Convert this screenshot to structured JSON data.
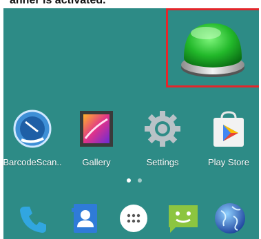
{
  "caption": "anner is activated.",
  "apps": [
    {
      "label": "BarcodeScan..",
      "icon": "barcode-scanner-icon"
    },
    {
      "label": "Gallery",
      "icon": "gallery-icon"
    },
    {
      "label": "Settings",
      "icon": "settings-gear-icon"
    },
    {
      "label": "Play Store",
      "icon": "play-store-icon"
    }
  ],
  "dock": [
    "phone-icon",
    "contacts-icon",
    "app-drawer-icon",
    "messaging-icon",
    "browser-globe-icon"
  ],
  "colors": {
    "background": "#2d8b86",
    "highlight": "#e3262b",
    "button": "#1fb52e"
  }
}
